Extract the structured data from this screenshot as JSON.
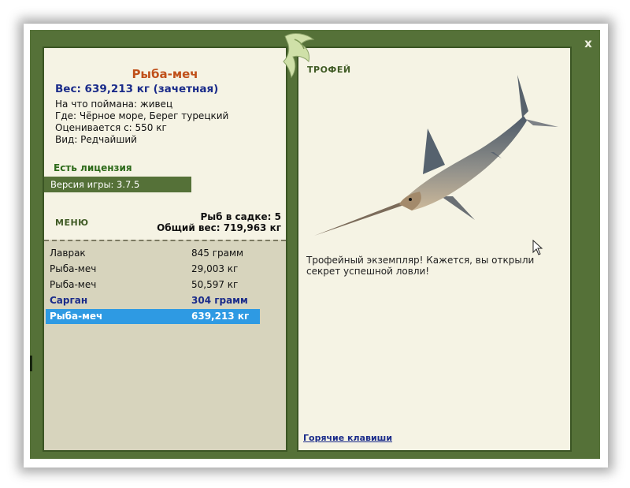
{
  "window": {
    "close_label": "x"
  },
  "fish": {
    "name": "Рыба-меч",
    "weight_line": "Вес: 639,213 кг (зачетная)",
    "info": [
      "На что поймана: живец",
      "Где: Чёрное море, Берег турецкий",
      "Оценивается с: 550 кг",
      "Вид: Редчайший"
    ]
  },
  "license": "Есть лицензия",
  "version": "Версия игры: 3.7.5",
  "menu_label": "МЕНЮ",
  "sadok": {
    "count_line": "Рыб в садке: 5",
    "total_line": "Общий вес: 719,963 кг"
  },
  "catches": [
    {
      "name": "Лаврак",
      "weight": "845 грамм",
      "style": "normal"
    },
    {
      "name": "Рыба-меч",
      "weight": "29,003 кг",
      "style": "normal"
    },
    {
      "name": "Рыба-меч",
      "weight": "50,597 кг",
      "style": "normal"
    },
    {
      "name": "Сарган",
      "weight": "304 грамм",
      "style": "bold"
    },
    {
      "name": "Рыба-меч",
      "weight": "639,213 кг",
      "style": "selected"
    }
  ],
  "trophy": {
    "title": "ТРОФЕЙ",
    "text": "Трофейный экземпляр! Кажется, вы открыли секрет успешной ловли!"
  },
  "hotkeys_label": "Горячие клавиши",
  "colors": {
    "frame": "#557138",
    "panel_bg": "#f5f3e4",
    "list_bg": "#d7d4bd",
    "selected_row": "#2e9ae3",
    "fish_name": "#c0501a",
    "weight_text": "#1b2c8a"
  },
  "icons": [
    "close-icon",
    "fish-emblem-icon",
    "mouse-cursor-icon"
  ]
}
